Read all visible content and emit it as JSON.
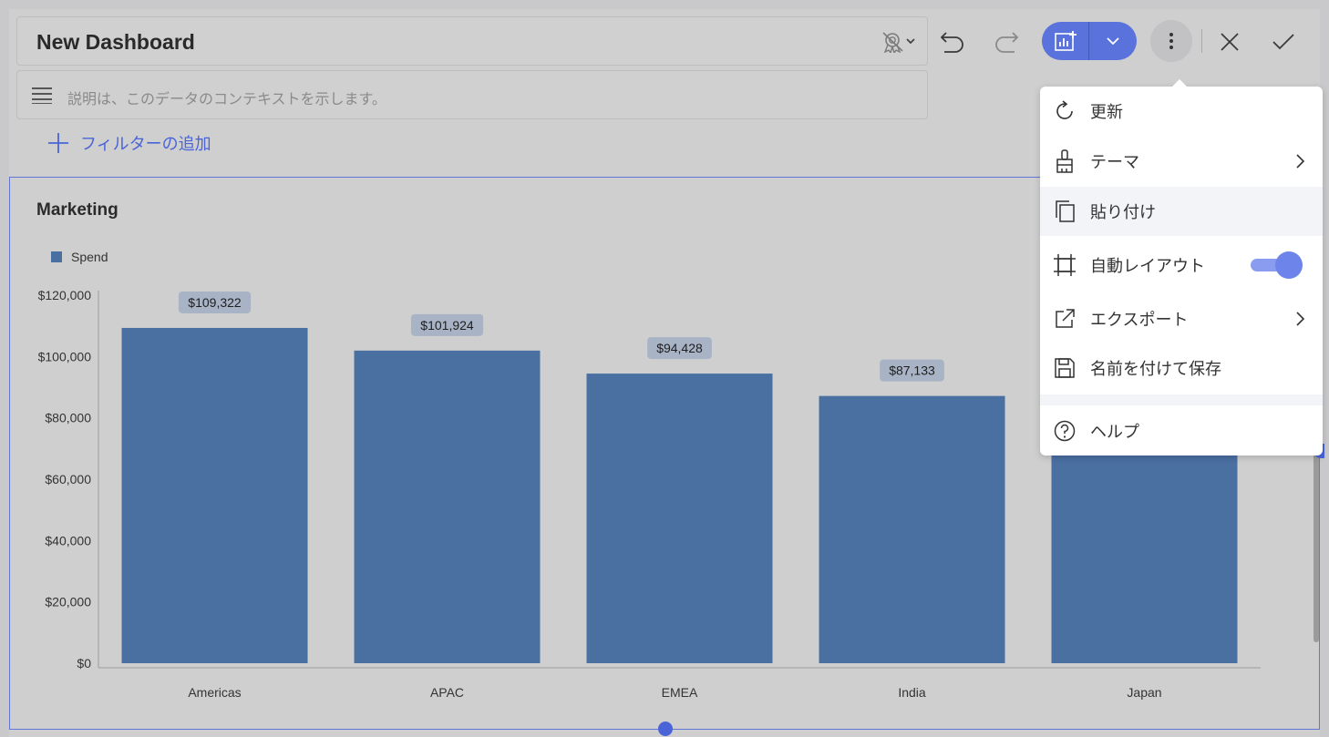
{
  "header": {
    "title": "New Dashboard",
    "description_placeholder": "説明は、このデータのコンテキストを示します。",
    "add_filter_label": "フィルターの追加"
  },
  "toolbar": {
    "icons": [
      "certification-icon",
      "undo-icon",
      "redo-icon",
      "add-visualization-icon",
      "chevron-down-icon",
      "more-vertical-icon",
      "close-icon",
      "check-icon"
    ],
    "accent_color": "#5a72dc"
  },
  "menu": {
    "items": [
      {
        "label": "更新",
        "icon": "refresh-icon"
      },
      {
        "label": "テーマ",
        "icon": "brush-icon",
        "submenu": true
      },
      {
        "label": "貼り付け",
        "icon": "paste-icon"
      },
      {
        "label": "自動レイアウト",
        "icon": "layout-icon",
        "toggle_on": true
      },
      {
        "label": "エクスポート",
        "icon": "export-icon",
        "submenu": true
      },
      {
        "label": "名前を付けて保存",
        "icon": "save-icon"
      },
      {
        "label": "ヘルプ",
        "icon": "help-icon"
      }
    ]
  },
  "widget": {
    "title": "Marketing"
  },
  "chart_data": {
    "type": "bar",
    "title": "Marketing",
    "categories": [
      "Americas",
      "APAC",
      "EMEA",
      "India",
      "Japan"
    ],
    "series": [
      {
        "name": "Spend",
        "values": [
          109322,
          101924,
          94428,
          87133,
          79800
        ],
        "color": "#4a70a2"
      }
    ],
    "data_labels": [
      "$109,322",
      "$101,924",
      "$94,428",
      "$87,133",
      null
    ],
    "y_ticks": [
      "$0",
      "$20,000",
      "$40,000",
      "$60,000",
      "$80,000",
      "$100,000",
      "$120,000"
    ],
    "ylim": [
      0,
      120000
    ],
    "legend_position": "top-left",
    "grid": false
  }
}
